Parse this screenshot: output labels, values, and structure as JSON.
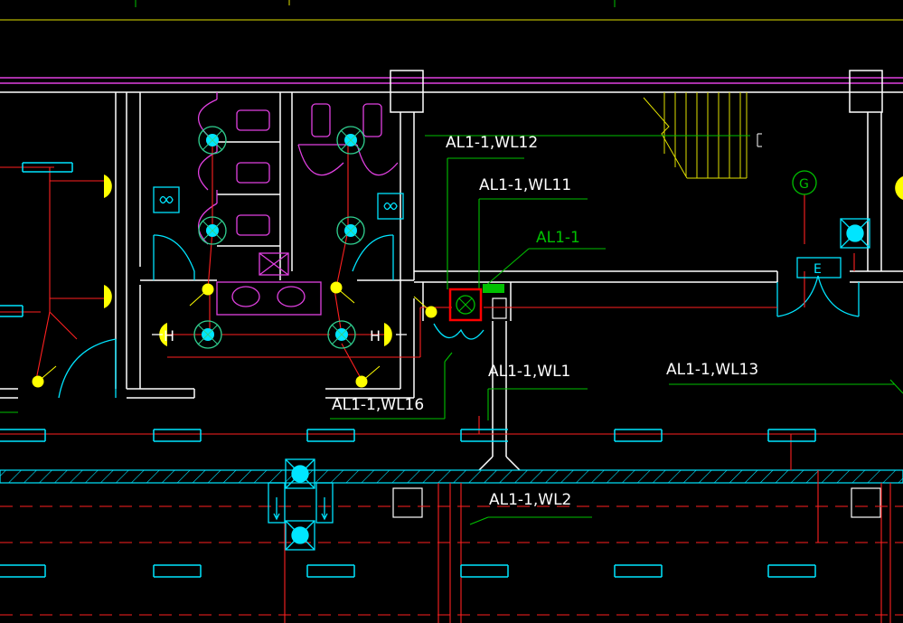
{
  "colors": {
    "background": "#000000",
    "wall": "#ffffff",
    "circuit": "#ff2020",
    "leader": "#00c000",
    "fixture": "#00e5ff",
    "lamp": "#ffff00",
    "sanitary": "#e040e0",
    "stair": "#e0e000",
    "highlight": "#ff0000"
  },
  "labels": {
    "wl12": "AL1-1,WL12",
    "wl11": "AL1-1,WL11",
    "panel": "AL1-1",
    "wl1": "AL1-1,WL1",
    "wl13": "AL1-1,WL13",
    "wl16": "AL1-1,WL16",
    "wl2": "AL1-1,WL2"
  },
  "symbols": {
    "h_left": "H",
    "h_right": "H",
    "generator": "G",
    "exit": "E"
  },
  "icons": {
    "ceiling_light": "ceiling-light-icon",
    "exhaust_fan": "exhaust-fan-icon",
    "wall_lamp": "wall-lamp-icon",
    "switch": "switch-icon",
    "distribution_panel": "distribution-panel-icon"
  }
}
